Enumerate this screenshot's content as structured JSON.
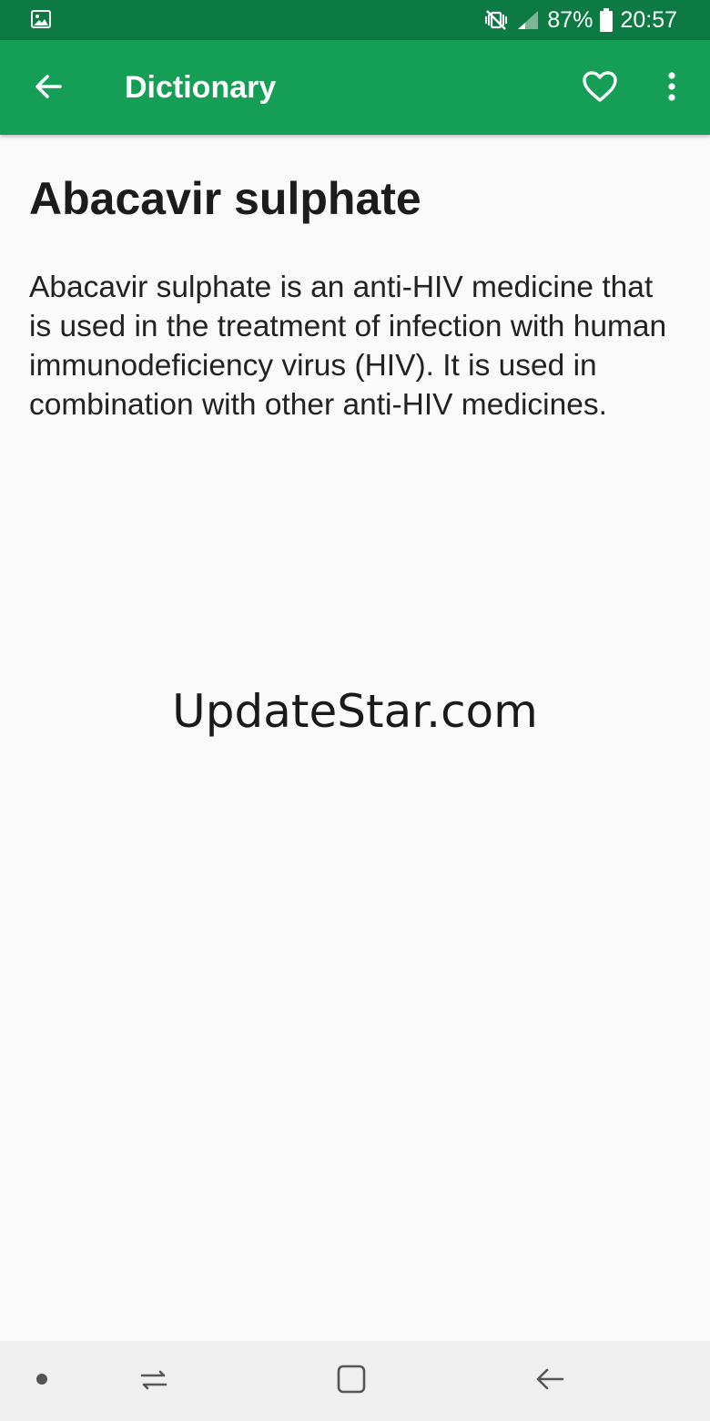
{
  "status_bar": {
    "battery": "87%",
    "time": "20:57",
    "icons": [
      "image-notification-icon",
      "vibrate-mute-icon",
      "signal-icon",
      "battery-icon"
    ]
  },
  "app_bar": {
    "title": "Dictionary",
    "background": "#149e56",
    "icons": [
      "back-arrow-icon",
      "heart-outline-icon",
      "more-vert-icon"
    ]
  },
  "entry": {
    "term": "Abacavir sulphate",
    "definition": "Abacavir sulphate is an anti-HIV medicine that is used in the treatment of infection with human immunodeficiency virus (HIV). It is used in combination with other anti-HIV medicines."
  },
  "watermark": "UpdateStar.com",
  "nav_bar": {
    "icons": [
      "dot-icon",
      "recent-apps-icon",
      "home-icon",
      "back-icon"
    ]
  }
}
